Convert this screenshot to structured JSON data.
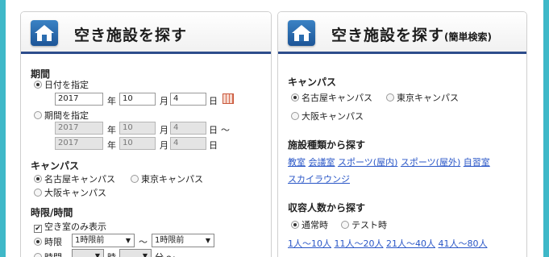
{
  "left": {
    "title": "空き施設を探す",
    "period": {
      "heading": "期間",
      "date_option": "日付を指定",
      "date": {
        "year": "2017",
        "month": "10",
        "day": "4"
      },
      "range_option": "期間を指定",
      "range_from": {
        "year": "2017",
        "month": "10",
        "day": "4"
      },
      "range_to": {
        "year": "2017",
        "month": "10",
        "day": "4"
      },
      "year_unit": "年",
      "month_unit": "月",
      "day_unit": "日",
      "tilde": "～"
    },
    "campus": {
      "heading": "キャンパス",
      "options": [
        "名古屋キャンパス",
        "東京キャンパス",
        "大阪キャンパス"
      ]
    },
    "time": {
      "heading": "時限/時間",
      "empty_only": "空き室のみ表示",
      "period_option": "時限",
      "period_from": "1時限前",
      "period_to": "1時限前",
      "tilde": "～",
      "time_option": "時間",
      "hour_unit": "時",
      "minute_unit": "分",
      "time_tail": "～"
    }
  },
  "right": {
    "title": "空き施設を探す",
    "subtitle": "(簡単検索)",
    "campus": {
      "heading": "キャンパス",
      "options": [
        "名古屋キャンパス",
        "東京キャンパス",
        "大阪キャンパス"
      ]
    },
    "facility": {
      "heading": "施設種類から探す",
      "links": [
        "教室",
        "会議室",
        "スポーツ(屋内)",
        "スポーツ(屋外)",
        "自習室",
        "スカイラウンジ"
      ]
    },
    "capacity": {
      "heading": "収容人数から探す",
      "modes": [
        "通常時",
        "テスト時"
      ],
      "links": [
        "1人～10人",
        "11人～20人",
        "21人～40人",
        "41人～80人"
      ]
    }
  }
}
